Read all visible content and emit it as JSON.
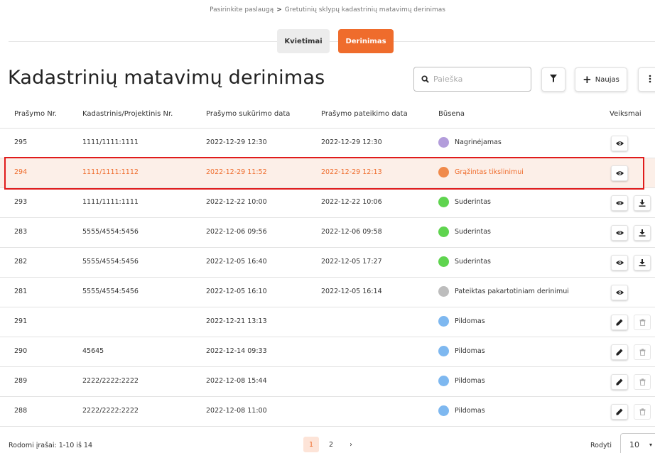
{
  "breadcrumb": {
    "step1": "Pasirinkite paslaugą",
    "separator": ">",
    "step2": "Gretutinių sklypų kadastrinių matavimų derinimas"
  },
  "tabs": [
    {
      "label": "Kvietimai",
      "active": false
    },
    {
      "label": "Derinimas",
      "active": true
    }
  ],
  "page_title": "Kadastrinių matavimų derinimas",
  "search": {
    "placeholder": "Paieška",
    "value": ""
  },
  "toolbar": {
    "new_label": "Naujas"
  },
  "table": {
    "headers": {
      "request_no": "Prašymo Nr.",
      "cadastral_no": "Kadastrinis/Projektinis Nr.",
      "created": "Prašymo sukūrimo data",
      "submitted": "Prašymo pateikimo data",
      "status": "Būsena",
      "actions": "Veiksmai"
    },
    "rows": [
      {
        "no": "295",
        "cad": "1111/1111:1111",
        "created": "2022-12-29 12:30",
        "submitted": "2022-12-29 12:30",
        "status": "Nagrinėjamas",
        "status_color": "#b39ddb",
        "actions": [
          "view"
        ]
      },
      {
        "no": "294",
        "cad": "1111/1111:1112",
        "created": "2022-12-29 11:52",
        "submitted": "2022-12-29 12:13",
        "status": "Grąžintas tikslinimui",
        "status_color": "#f08a4b",
        "actions": [
          "view"
        ],
        "highlighted": true
      },
      {
        "no": "293",
        "cad": "1111/1111:1111",
        "created": "2022-12-22 10:00",
        "submitted": "2022-12-22 10:06",
        "status": "Suderintas",
        "status_color": "#5fd44f",
        "actions": [
          "view",
          "download"
        ]
      },
      {
        "no": "283",
        "cad": "5555/4554:5456",
        "created": "2022-12-06 09:56",
        "submitted": "2022-12-06 09:58",
        "status": "Suderintas",
        "status_color": "#5fd44f",
        "actions": [
          "view",
          "download"
        ]
      },
      {
        "no": "282",
        "cad": "5555/4554:5456",
        "created": "2022-12-05 16:40",
        "submitted": "2022-12-05 17:27",
        "status": "Suderintas",
        "status_color": "#5fd44f",
        "actions": [
          "view",
          "download"
        ]
      },
      {
        "no": "281",
        "cad": "5555/4554:5456",
        "created": "2022-12-05 16:10",
        "submitted": "2022-12-05 16:14",
        "status": "Pateiktas pakartotiniam derinimui",
        "status_color": "#bdbdbd",
        "actions": [
          "view"
        ]
      },
      {
        "no": "291",
        "cad": "",
        "created": "2022-12-21 13:13",
        "submitted": "",
        "status": "Pildomas",
        "status_color": "#7eb8f0",
        "actions": [
          "edit",
          "delete"
        ]
      },
      {
        "no": "290",
        "cad": "45645",
        "created": "2022-12-14 09:33",
        "submitted": "",
        "status": "Pildomas",
        "status_color": "#7eb8f0",
        "actions": [
          "edit",
          "delete"
        ]
      },
      {
        "no": "289",
        "cad": "2222/2222:2222",
        "created": "2022-12-08 15:44",
        "submitted": "",
        "status": "Pildomas",
        "status_color": "#7eb8f0",
        "actions": [
          "edit",
          "delete"
        ]
      },
      {
        "no": "288",
        "cad": "2222/2222:2222",
        "created": "2022-12-08 11:00",
        "submitted": "",
        "status": "Pildomas",
        "status_color": "#7eb8f0",
        "actions": [
          "edit",
          "delete"
        ]
      }
    ]
  },
  "footer": {
    "records_text": "Rodomi įrašai: 1-10 iš 14",
    "pages": [
      "1",
      "2"
    ],
    "current_page": "1",
    "next": "›",
    "per_page_label": "Rodyti",
    "per_page_value": "10"
  },
  "colors": {
    "accent": "#ef6c2c",
    "highlight_border": "#e01b1b",
    "highlight_bg": "#fcefe8"
  }
}
